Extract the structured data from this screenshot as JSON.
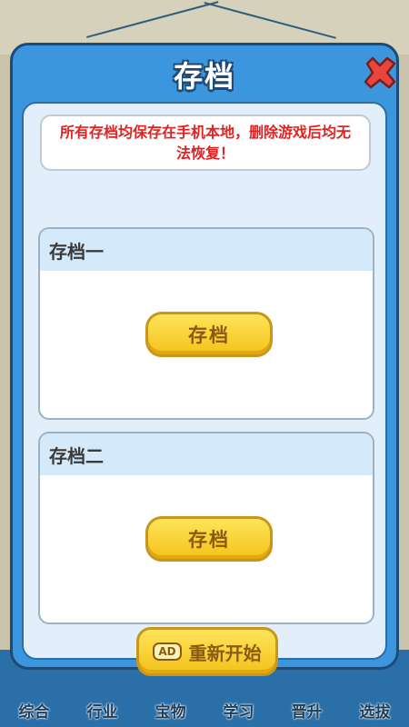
{
  "modal": {
    "title": "存档",
    "notice": "所有存档均保存在手机本地，删除游戏后均无法恢复！",
    "slots": [
      {
        "name": "存档一",
        "button_label": "存档"
      },
      {
        "name": "存档二",
        "button_label": "存档"
      }
    ],
    "restart": {
      "ad_label": "AD",
      "label": "重新开始"
    }
  },
  "bottom_nav": {
    "items": [
      "综合",
      "行业",
      "宝物",
      "学习",
      "晋升",
      "选拔"
    ]
  },
  "colors": {
    "modal_blue": "#3c96de",
    "notice_red": "#e32121",
    "button_yellow": "#f3c21a",
    "close_red": "#e8463d"
  }
}
